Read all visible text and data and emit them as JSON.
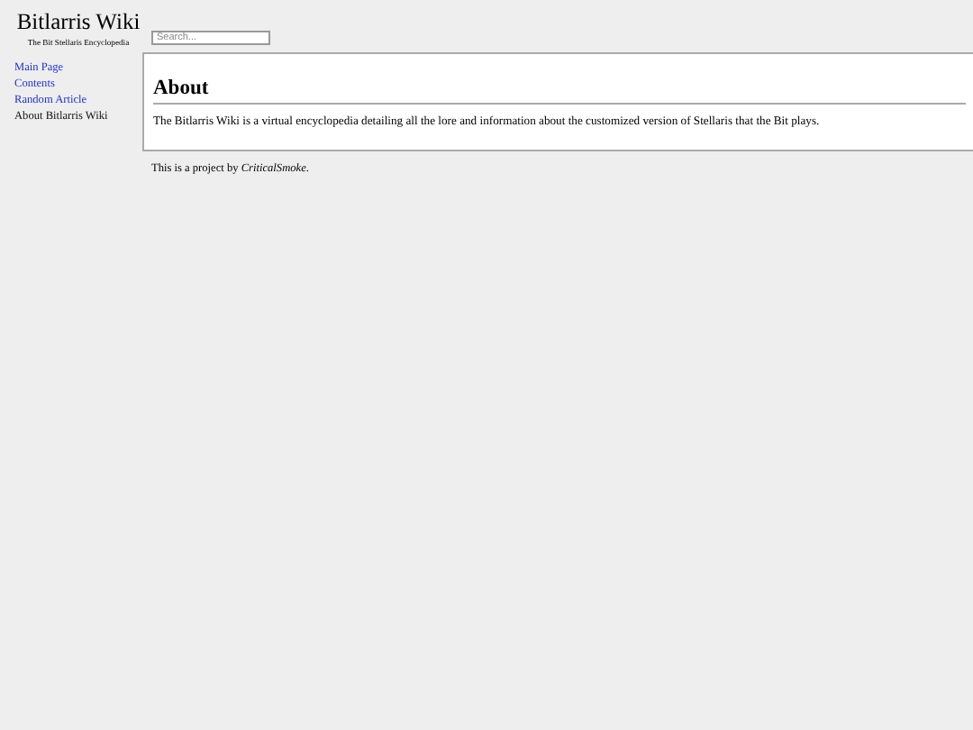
{
  "site": {
    "title": "Bitlarris Wiki",
    "tagline": "The Bit Stellaris Encyclopedia"
  },
  "search": {
    "placeholder": "Search..."
  },
  "nav": [
    {
      "label": "Main Page",
      "selected": false
    },
    {
      "label": "Contents",
      "selected": false
    },
    {
      "label": "Random Article",
      "selected": false
    },
    {
      "label": "About Bitlarris Wiki",
      "selected": true
    }
  ],
  "article": {
    "heading": "About",
    "body": "The Bitlarris Wiki is a virtual encyclopedia detailing all the lore and information about the customized version of Stellaris that the Bit plays."
  },
  "footer": "This is a project by *CriticalSmoke*."
}
